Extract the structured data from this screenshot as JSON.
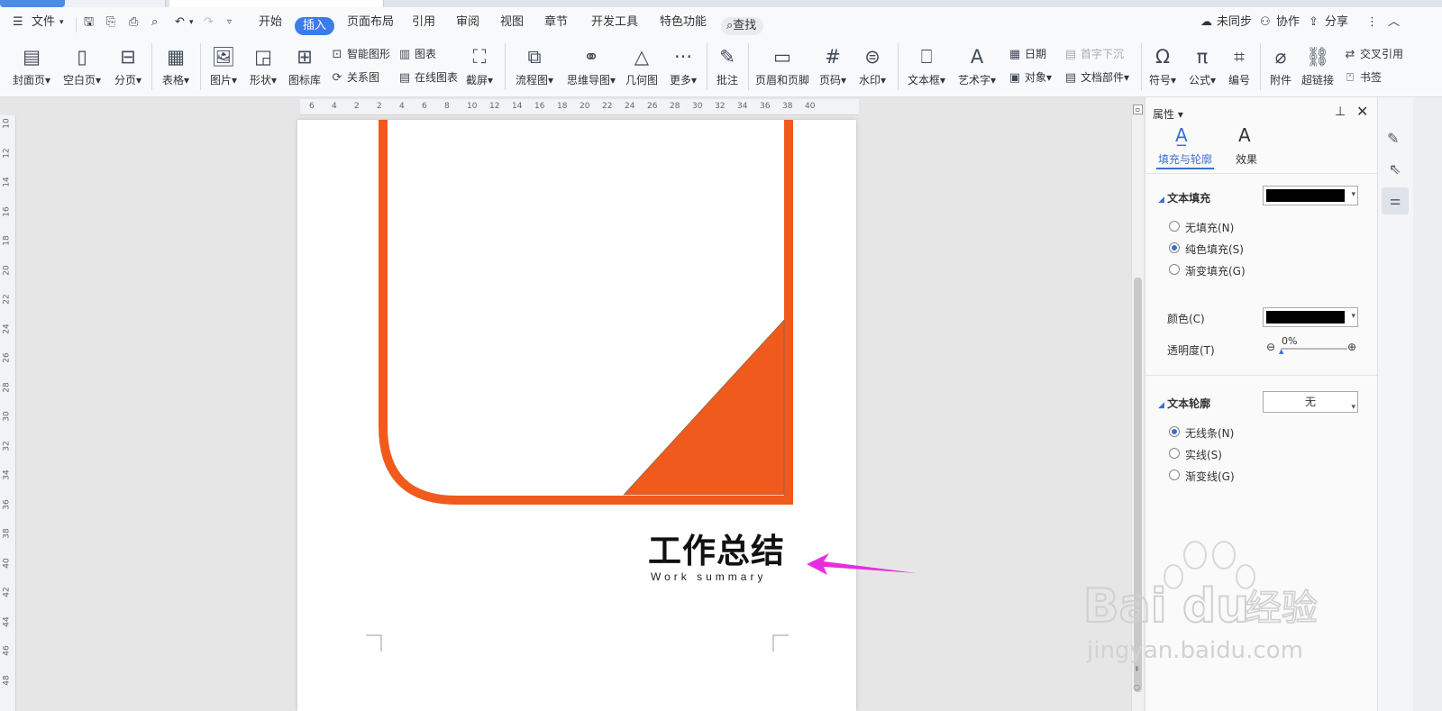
{
  "menu": {
    "file": "文件",
    "tabs": [
      "开始",
      "插入",
      "页面布局",
      "引用",
      "审阅",
      "视图",
      "章节",
      "开发工具",
      "特色功能"
    ],
    "active_tab": "插入",
    "search": "查找",
    "unsynced": "未同步",
    "collab": "协作",
    "share": "分享"
  },
  "ribbon": {
    "cover": "封面页",
    "blank": "空白页",
    "pagebreak": "分页",
    "table": "表格",
    "picture": "图片",
    "shape": "形状",
    "iconlib": "图标库",
    "smartart": "智能图形",
    "chart": "图表",
    "relation": "关系图",
    "onlinechart": "在线图表",
    "screenshot": "截屏",
    "flowchart": "流程图",
    "mindmap": "思维导图",
    "geometry": "几何图",
    "more": "更多",
    "comment": "批注",
    "headerfooter": "页眉和页脚",
    "pagenum": "页码",
    "watermark": "水印",
    "textbox": "文本框",
    "wordart": "艺术字",
    "date": "日期",
    "object": "对象",
    "dropcap": "首字下沉",
    "docpart": "文档部件",
    "symbol": "符号",
    "formula": "公式",
    "numbering": "编号",
    "attachment": "附件",
    "hyperlink": "超链接",
    "crossref": "交叉引用",
    "bookmark": "书签"
  },
  "ruler": {
    "h": [
      "6",
      "4",
      "2",
      "2",
      "4",
      "6",
      "8",
      "10",
      "12",
      "14",
      "16",
      "18",
      "20",
      "22",
      "24",
      "26",
      "28",
      "30",
      "32",
      "34",
      "36",
      "38",
      "40"
    ],
    "v": [
      "10",
      "12",
      "14",
      "16",
      "18",
      "20",
      "22",
      "24",
      "26",
      "28",
      "30",
      "32",
      "34",
      "36",
      "38",
      "40",
      "42",
      "44",
      "46",
      "48"
    ]
  },
  "document": {
    "title": "工作总结",
    "subtitle": "Work summary",
    "accent_color": "#f05a1c"
  },
  "panel": {
    "title": "属性",
    "tab_fill": "填充与轮廓",
    "tab_effect": "效果",
    "text_fill": "文本填充",
    "fill_options": [
      "无填充(N)",
      "纯色填充(S)",
      "渐变填充(G)"
    ],
    "fill_selected": 1,
    "color_label": "颜色(C)",
    "fill_color": "#000000",
    "transparency_label": "透明度(T)",
    "transparency_value": "0%",
    "text_outline": "文本轮廓",
    "outline_value": "无",
    "outline_options": [
      "无线条(N)",
      "实线(S)",
      "渐变线(G)"
    ],
    "outline_selected": 0
  },
  "watermark": {
    "brand": "Bai",
    "brand2": "du",
    "brand_cn": "经验",
    "url": "jingyan.baidu.com"
  }
}
